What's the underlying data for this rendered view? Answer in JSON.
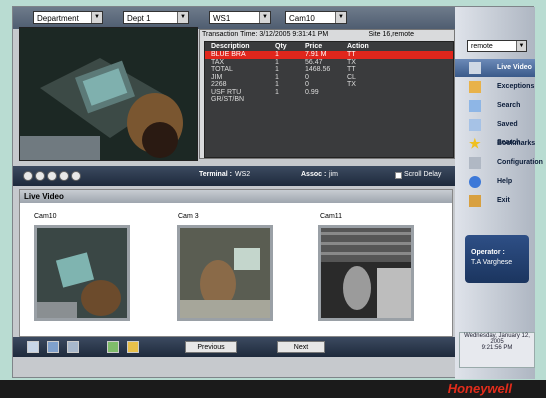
{
  "filters": {
    "department": "Department",
    "dept": "Dept 1",
    "ws": "WS1",
    "cam": "Cam10"
  },
  "transaction": {
    "time": "Transaction Time: 3/12/2005 9:31:41 PM",
    "site": "Site 16,remote",
    "columns": [
      "Description",
      "Qty",
      "Price",
      "Action"
    ],
    "rows": [
      {
        "desc": "BLUE BRA",
        "qty": "1",
        "price": "7.91 M",
        "action": "TT",
        "selected": true
      },
      {
        "desc": "TAX",
        "qty": "1",
        "price": "56.47",
        "action": "TX"
      },
      {
        "desc": "TOTAL",
        "qty": "1",
        "price": "1468.56",
        "action": "TT"
      },
      {
        "desc": "JIM",
        "qty": "1",
        "price": "0",
        "action": "CL"
      },
      {
        "desc": "2268",
        "qty": "1",
        "price": "0",
        "action": "TX"
      },
      {
        "desc": "USF RTU GR/ST/BN",
        "qty": "1",
        "price": "0.99",
        "action": ""
      }
    ]
  },
  "controls": {
    "terminal_label": "Terminal :",
    "terminal_value": "WS2",
    "assoc_label": "Assoc :",
    "assoc_value": "jim",
    "scroll_delay": "Scroll Delay"
  },
  "live": {
    "title": "Live Video",
    "cams": [
      "Cam10",
      "Cam 3",
      "Cam11"
    ]
  },
  "buttons": {
    "previous": "Previous",
    "next": "Next"
  },
  "sidebar": {
    "site_select": "remote",
    "items": [
      "Live Video",
      "Exceptions",
      "Search",
      "Saved Search",
      "Bookmarks",
      "Configuration",
      "Help",
      "Exit"
    ]
  },
  "operator": {
    "label": "Operator :",
    "name": "T.A Varghese"
  },
  "date": {
    "line1": "Wednesday, January 12,",
    "line2": "2005",
    "line3": "9:21:56 PM"
  },
  "brand": "Honeywell",
  "colors": {
    "accent": "#e32c1b",
    "nav": "#3a5a8a"
  }
}
